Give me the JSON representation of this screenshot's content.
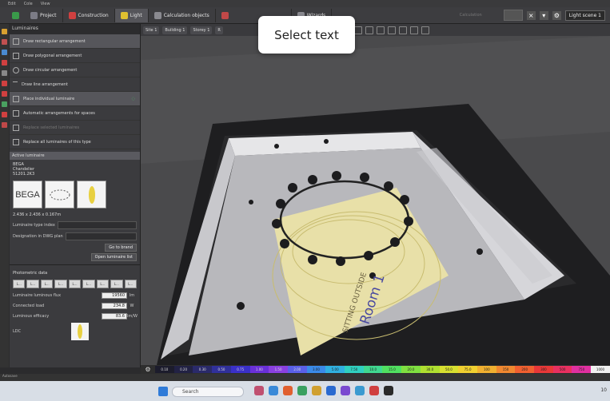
{
  "menubar": {
    "items": [
      "Edit",
      "Cole",
      "View"
    ]
  },
  "ribbon": {
    "tabs": [
      {
        "label": "Project",
        "color": "#7c7c86"
      },
      {
        "label": "Construction",
        "color": "#d04040"
      },
      {
        "label": "Light",
        "color": "#e0c030",
        "active": true
      },
      {
        "label": "Calculation objects",
        "color": "#8a8a90"
      },
      {
        "label": "Wizards",
        "color": "#8a8a90"
      }
    ],
    "calculation_label": "Calculation",
    "scene_label": "Light scene 1"
  },
  "toolbar2": {
    "breadcrumbs": [
      "Site 1",
      "Building 1",
      "Storey 1",
      "R"
    ]
  },
  "tooltip": {
    "text": "Select text"
  },
  "panel": {
    "title": "Luminaires",
    "items": [
      {
        "label": "Draw rectangular arrangement",
        "highlight": true
      },
      {
        "label": "Draw polygonal arrangement"
      },
      {
        "label": "Draw circular arrangement"
      },
      {
        "label": "Draw line arrangement"
      },
      {
        "label": "Place individual luminaire",
        "highlight": true
      },
      {
        "label": "Automatic arrangements for spaces"
      },
      {
        "label": "Replace selected luminaires",
        "dim": true
      },
      {
        "label": "Replace all luminaires of this type"
      }
    ],
    "active_section": "Active luminaire",
    "luminaire": {
      "brand": "BEGA",
      "name": "Chandelier",
      "code": "51201.2K3",
      "thumb_logo": "BEGA",
      "dimensions": "2.436 x 2.436 x 0.167m",
      "type_index_label": "Luminaire type index",
      "designation_label": "Designation in DWG plan",
      "go_to_brand": "Go to brand",
      "open_luminaire_list": "Open luminaire list"
    },
    "photometric": {
      "title": "Photometric data",
      "tabs": [
        "L...",
        "L...",
        "L...",
        "L...",
        "L...",
        "L...",
        "L...",
        "L...",
        "L..."
      ],
      "rows": [
        {
          "label": "Luminaire luminous flux",
          "value": "19560",
          "unit": "lm"
        },
        {
          "label": "Connected load",
          "value": "234.8",
          "unit": "W"
        },
        {
          "label": "Luminous efficacy",
          "value": "83.6",
          "unit": "lm/W"
        }
      ],
      "ldc_label": "LDC"
    }
  },
  "viewport": {
    "room_label": "Room 1",
    "side_label": "SITTING OUTSIDE"
  },
  "legend": {
    "values": [
      "0.10",
      "0.20",
      "0.30",
      "0.50",
      "0.75",
      "1.00",
      "1.50",
      "2.00",
      "3.00",
      "5.00",
      "7.50",
      "10.0",
      "15.0",
      "20.0",
      "30.0",
      "50.0",
      "75.0",
      "100",
      "150",
      "200",
      "300",
      "500",
      "750",
      "1000"
    ],
    "colors": [
      "#1c1c2c",
      "#222244",
      "#2a2a6a",
      "#30309a",
      "#3a30c8",
      "#6a30d8",
      "#8a40e0",
      "#5a60e8",
      "#3a8ae8",
      "#30b0e0",
      "#30d0c0",
      "#40d890",
      "#50e060",
      "#80e040",
      "#b0e030",
      "#d8e030",
      "#f0d030",
      "#f0b030",
      "#f08830",
      "#f06030",
      "#e83838",
      "#e83060",
      "#e030a0",
      "#f0f0f0"
    ]
  },
  "statusbar": {
    "text": "Autosave"
  },
  "taskbar": {
    "search_placeholder": "Search",
    "clock": "10"
  }
}
